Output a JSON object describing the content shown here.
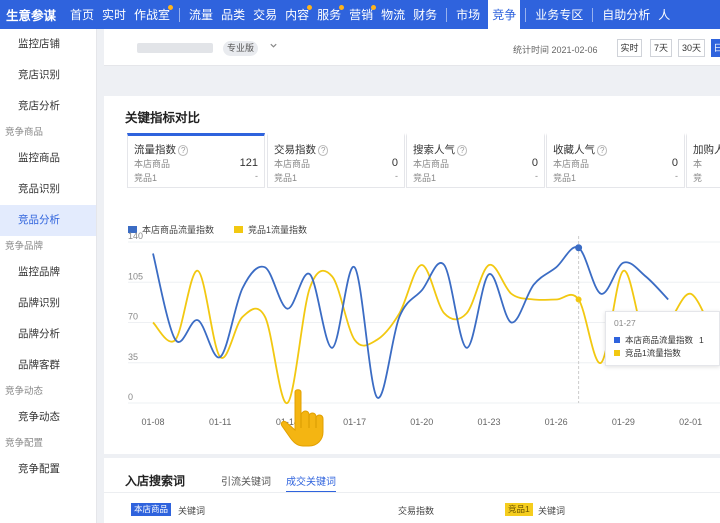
{
  "topnav": {
    "brand": "生意参谋",
    "items": [
      {
        "label": "首页",
        "dot": false
      },
      {
        "label": "实时",
        "dot": false
      },
      {
        "label": "作战室",
        "dot": true
      },
      {
        "label": "流量",
        "dot": false
      },
      {
        "label": "品类",
        "dot": false
      },
      {
        "label": "交易",
        "dot": false
      },
      {
        "label": "内容",
        "dot": true
      },
      {
        "label": "服务",
        "dot": true
      },
      {
        "label": "营销",
        "dot": true
      },
      {
        "label": "物流",
        "dot": false
      },
      {
        "label": "财务",
        "dot": false
      },
      {
        "label": "市场",
        "dot": false
      },
      {
        "label": "竞争",
        "dot": false,
        "active": true
      },
      {
        "label": "业务专区",
        "dot": false
      },
      {
        "label": "自助分析",
        "dot": false
      },
      {
        "label": "人",
        "dot": false
      }
    ]
  },
  "sidebar": {
    "items": [
      {
        "type": "item",
        "label": "监控店铺"
      },
      {
        "type": "item",
        "label": "竞店识别"
      },
      {
        "type": "item",
        "label": "竞店分析"
      },
      {
        "type": "group",
        "label": "竞争商品"
      },
      {
        "type": "item",
        "label": "监控商品"
      },
      {
        "type": "item",
        "label": "竞品识别"
      },
      {
        "type": "item",
        "label": "竞品分析",
        "active": true
      },
      {
        "type": "group",
        "label": "竞争品牌"
      },
      {
        "type": "item",
        "label": "监控品牌"
      },
      {
        "type": "item",
        "label": "品牌识别"
      },
      {
        "type": "item",
        "label": "品牌分析"
      },
      {
        "type": "item",
        "label": "品牌客群"
      },
      {
        "type": "group",
        "label": "竞争动态"
      },
      {
        "type": "item",
        "label": "竞争动态"
      },
      {
        "type": "group",
        "label": "竞争配置"
      },
      {
        "type": "item",
        "label": "竞争配置"
      }
    ]
  },
  "filterbar": {
    "badge": "专业版",
    "stat_time": "统计时间 2021-02-06",
    "buttons": [
      "实时",
      "7天",
      "30天",
      "日"
    ]
  },
  "card": {
    "title": "关键指标对比",
    "metrics": [
      {
        "label": "流量指数",
        "row1": "本店商品",
        "val1": "121",
        "row2": "竞品1",
        "val2": "-"
      },
      {
        "label": "交易指数",
        "row1": "本店商品",
        "val1": "0",
        "row2": "竞品1",
        "val2": "-"
      },
      {
        "label": "搜索人气",
        "row1": "本店商品",
        "val1": "0",
        "row2": "竞品1",
        "val2": "-"
      },
      {
        "label": "收藏人气",
        "row1": "本店商品",
        "val1": "0",
        "row2": "竞品1",
        "val2": "-"
      },
      {
        "label": "加购人",
        "row1": "本",
        "val1": "",
        "row2": "竞",
        "val2": ""
      }
    ]
  },
  "chart_data": {
    "type": "line",
    "x": [
      "01-08",
      "01-09",
      "01-10",
      "01-11",
      "01-12",
      "01-13",
      "01-14",
      "01-15",
      "01-16",
      "01-17",
      "01-18",
      "01-19",
      "01-20",
      "01-21",
      "01-22",
      "01-23",
      "01-24",
      "01-25",
      "01-26",
      "01-27",
      "01-28",
      "01-29",
      "01-30",
      "01-31",
      "02-01",
      "02-02"
    ],
    "xticks": [
      "01-08",
      "01-11",
      "01-14",
      "01-17",
      "01-20",
      "01-23",
      "01-26",
      "01-29",
      "02-01"
    ],
    "yticks": [
      0,
      35,
      70,
      105,
      140
    ],
    "ylim": [
      0,
      140
    ],
    "series": [
      {
        "name": "本店商品流量指数",
        "color": "#3b6cc4",
        "values": [
          130,
          55,
          72,
          40,
          100,
          118,
          82,
          112,
          48,
          118,
          5,
          75,
          98,
          120,
          48,
          112,
          70,
          103,
          118,
          135,
          95,
          122,
          110,
          90,
          null,
          null
        ]
      },
      {
        "name": "竞品1流量指数",
        "color": "#f2c811",
        "values": [
          70,
          55,
          115,
          40,
          75,
          75,
          0,
          100,
          110,
          55,
          55,
          78,
          120,
          78,
          78,
          120,
          95,
          90,
          90,
          90,
          35,
          115,
          55,
          70,
          95,
          60
        ]
      }
    ]
  },
  "tooltip": {
    "date": "01-27",
    "rows": [
      {
        "label": "本店商品流量指数",
        "value": "1",
        "color": "#2f63dd"
      },
      {
        "label": "竞品1流量指数",
        "value": "",
        "color": "#f2c811"
      }
    ]
  },
  "bottom": {
    "title": "入店搜索词",
    "tabs": [
      {
        "label": "引流关键词",
        "active": false
      },
      {
        "label": "成交关键词",
        "active": true
      }
    ],
    "pill_blue": "本店商品",
    "col_keyword": "关键词",
    "col_trade": "交易指数",
    "pill_yellow": "竞品1",
    "col_keyword2": "关键词"
  }
}
